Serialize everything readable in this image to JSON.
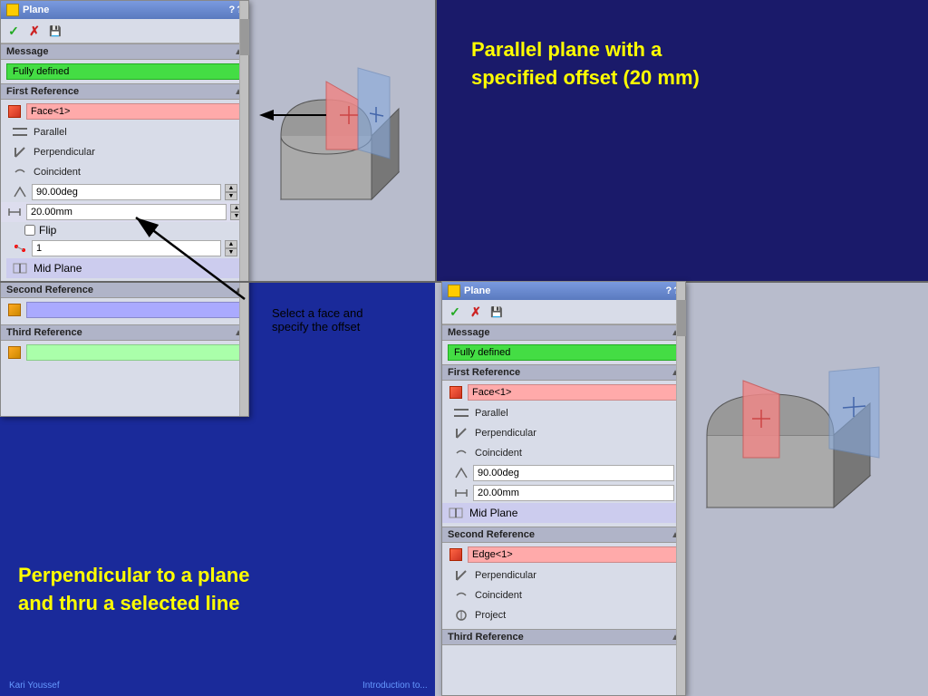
{
  "top_right_text": {
    "line1": "Parallel plane with a",
    "line2": "specified offset (20 mm)"
  },
  "bottom_left_text": {
    "line1": "Perpendicular to a plane",
    "line2": "and thru a selected line"
  },
  "annotation_text": "Select a face and\nspecify the offset",
  "footer": {
    "left": "Kari Youssef",
    "center": "Introduction to..."
  },
  "dialog1": {
    "title": "Plane",
    "help1": "?",
    "help2": "?",
    "toolbar": {
      "check": "✓",
      "cross": "✗",
      "save": "🖫"
    },
    "sections": {
      "message": {
        "label": "Message",
        "status": "Fully defined"
      },
      "first_reference": {
        "label": "First Reference",
        "face_value": "Face<1>",
        "options": [
          {
            "label": "Parallel"
          },
          {
            "label": "Perpendicular"
          },
          {
            "label": "Coincident"
          }
        ],
        "angle_value": "90.00deg",
        "distance_value": "20.00mm",
        "flip": "Flip",
        "instances": "1",
        "mid_plane": "Mid Plane"
      },
      "second_reference": {
        "label": "Second Reference",
        "value": ""
      },
      "third_reference": {
        "label": "Third Reference",
        "value": ""
      }
    }
  },
  "dialog2": {
    "title": "Plane",
    "help1": "?",
    "help2": "?",
    "sections": {
      "message": {
        "label": "Message",
        "status": "Fully defined"
      },
      "first_reference": {
        "label": "First Reference",
        "face_value": "Face<1>",
        "options": [
          {
            "label": "Parallel"
          },
          {
            "label": "Perpendicular"
          },
          {
            "label": "Coincident"
          }
        ],
        "angle_value": "90.00deg",
        "distance_value": "20.00mm",
        "mid_plane": "Mid Plane"
      },
      "second_reference": {
        "label": "Second Reference",
        "edge_value": "Edge<1>",
        "options": [
          {
            "label": "Perpendicular"
          },
          {
            "label": "Coincident"
          },
          {
            "label": "Project"
          }
        ]
      },
      "third_reference": {
        "label": "Third Reference"
      }
    }
  }
}
